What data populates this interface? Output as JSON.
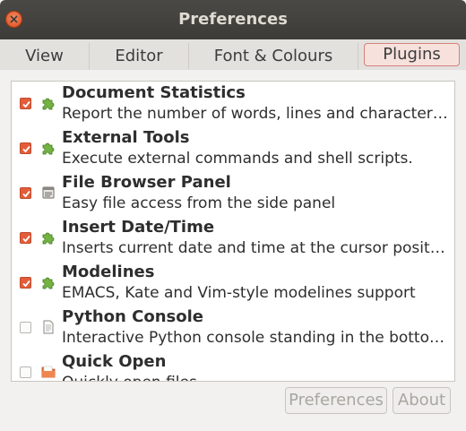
{
  "window": {
    "title": "Preferences"
  },
  "tabs": [
    {
      "label": "View"
    },
    {
      "label": "Editor"
    },
    {
      "label": "Font & Colours"
    },
    {
      "label": "Plugins"
    }
  ],
  "plugins": [
    {
      "name": "Document Statistics",
      "description": "Report the number of words, lines and characters in a document",
      "enabled": true,
      "icon": "puzzle-icon"
    },
    {
      "name": "External Tools",
      "description": "Execute external commands and shell scripts.",
      "enabled": true,
      "icon": "puzzle-icon"
    },
    {
      "name": "File Browser Panel",
      "description": "Easy file access from the side panel",
      "enabled": true,
      "icon": "file-browser-icon"
    },
    {
      "name": "Insert Date/Time",
      "description": "Inserts current date and time at the cursor position",
      "enabled": true,
      "icon": "puzzle-icon"
    },
    {
      "name": "Modelines",
      "description": "EMACS, Kate and Vim-style modelines support",
      "enabled": true,
      "icon": "puzzle-icon"
    },
    {
      "name": "Python Console",
      "description": "Interactive Python console standing in the bottom panel",
      "enabled": false,
      "icon": "document-icon"
    },
    {
      "name": "Quick Open",
      "description": "Quickly open files",
      "enabled": false,
      "icon": "folder-icon"
    }
  ],
  "buttons": {
    "preferences": "Preferences",
    "about": "About"
  },
  "colors": {
    "accent": "#e35d3a",
    "titlebar": "#3c3b37"
  }
}
